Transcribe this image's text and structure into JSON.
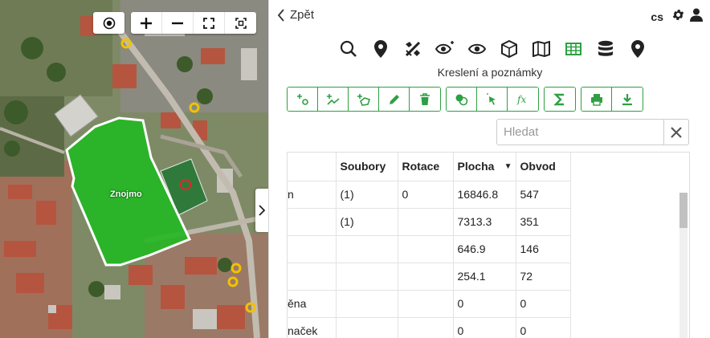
{
  "map": {
    "feature_label": "Znojmo",
    "tools": {
      "locate_icon": "target-icon",
      "zoom_in_icon": "plus-icon",
      "zoom_out_icon": "minus-icon",
      "fullscreen_icon": "fullscreen-icon",
      "fit_icon": "fit-extent-icon"
    },
    "colors": {
      "polygon": "#22b822",
      "polygon_stroke": "#ffffff",
      "marker": "#f2c200",
      "selected": "#e0282e"
    }
  },
  "panel": {
    "back_label": "Zpět",
    "language": "cs",
    "section_title": "Kreslení a poznámky",
    "search": {
      "placeholder": "Hledat",
      "value": ""
    },
    "icons": [
      "search-icon",
      "map-marker-icon",
      "tools-icon",
      "eye-scan-icon",
      "eye-icon",
      "cube-icon",
      "map-icon",
      "table-icon",
      "database-icon",
      "place-icon"
    ],
    "accent": "#2ea043",
    "table": {
      "columns": [
        "",
        "Soubory",
        "Rotace",
        "Plocha",
        "Obvod"
      ],
      "sorted_column": "Plocha",
      "rows": [
        [
          "n",
          "(1)",
          "0",
          "16846.8",
          "547"
        ],
        [
          "",
          "(1)",
          "",
          "7313.3",
          "351"
        ],
        [
          "",
          "",
          "",
          "646.9",
          "146"
        ],
        [
          "",
          "",
          "",
          "254.1",
          "72"
        ],
        [
          "ěna",
          "",
          "",
          "0",
          "0"
        ],
        [
          "naček",
          "",
          "",
          "0",
          "0"
        ]
      ]
    }
  }
}
